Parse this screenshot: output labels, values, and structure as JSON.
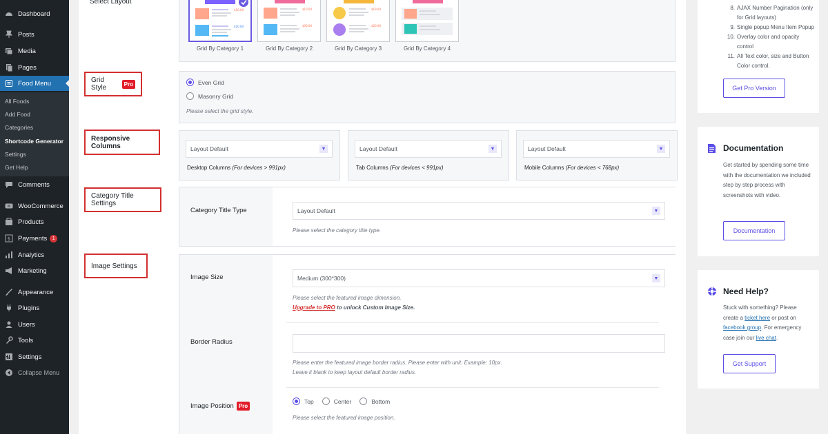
{
  "sidebar": {
    "items": [
      {
        "label": "Dashboard",
        "icon": "dashboard-icon"
      },
      {
        "label": "Posts",
        "icon": "pin-icon"
      },
      {
        "label": "Media",
        "icon": "media-icon"
      },
      {
        "label": "Pages",
        "icon": "pages-icon"
      },
      {
        "label": "Food Menu",
        "icon": "food-menu-icon"
      },
      {
        "label": "Comments",
        "icon": "comment-icon"
      },
      {
        "label": "WooCommerce",
        "icon": "woocommerce-icon"
      },
      {
        "label": "Products",
        "icon": "products-icon"
      },
      {
        "label": "Payments",
        "icon": "payments-icon",
        "badge": "1"
      },
      {
        "label": "Analytics",
        "icon": "analytics-icon"
      },
      {
        "label": "Marketing",
        "icon": "megaphone-icon"
      },
      {
        "label": "Appearance",
        "icon": "brush-icon"
      },
      {
        "label": "Plugins",
        "icon": "plugin-icon"
      },
      {
        "label": "Users",
        "icon": "users-icon"
      },
      {
        "label": "Tools",
        "icon": "tools-icon"
      },
      {
        "label": "Settings",
        "icon": "settings-icon"
      },
      {
        "label": "Collapse Menu",
        "icon": "collapse-icon"
      }
    ],
    "submenu": [
      "All Foods",
      "Add Food",
      "Categories",
      "Shortcode Generator",
      "Settings",
      "Get Help"
    ]
  },
  "layout": {
    "heading": "Select Layout",
    "options": [
      "Grid By Category 1",
      "Grid By Category 2",
      "Grid By Category 3",
      "Grid By Category 4"
    ],
    "prices": [
      "$10.00",
      "$20.00",
      "$10.00",
      "$30.00",
      "$19.00",
      "$20.00"
    ]
  },
  "grid_style": {
    "label": "Grid Style",
    "pro": "Pro",
    "options": [
      "Even Grid",
      "Masonry Grid"
    ],
    "help": "Please select the grid style."
  },
  "responsive": {
    "label": "Responsive Columns",
    "columns": [
      {
        "value": "Layout Default",
        "label": "Desktop Columns",
        "hint": "(For devices > 991px)"
      },
      {
        "value": "Layout Default",
        "label": "Tab Columns",
        "hint": "(For devices < 991px)"
      },
      {
        "value": "Layout Default",
        "label": "Mobile Columns",
        "hint": "(For devices < 768px)"
      }
    ]
  },
  "category_title": {
    "label": "Category Title Settings",
    "field": "Category Title Type",
    "value": "Layout Default",
    "help": "Please select the category title type."
  },
  "image_settings": {
    "label": "Image Settings",
    "size_label": "Image Size",
    "size_value": "Medium (300*300)",
    "size_help": "Please select the featured image dimension.",
    "upgrade_link": "Upgrade to PRO",
    "upgrade_rest": " to unlock Custom Image Size.",
    "radius_label": "Border Radius",
    "radius_help1": "Please enter the featured image border radius. Please enter with unit. Example: 10px.",
    "radius_help2": "Leave it blank to keep layout default border radius.",
    "position_label": "Image Position",
    "pro": "Pro",
    "positions": [
      "Top",
      "Center",
      "Bottom"
    ],
    "position_help": "Please select the featured image position."
  },
  "pro_card": {
    "features": [
      {
        "num": "8.",
        "text": "AJAX Number Pagination (only for Grid layouts)"
      },
      {
        "num": "9.",
        "text": "Single popup Menu Item Popup"
      },
      {
        "num": "10.",
        "text": "Overlay color and opacity control"
      },
      {
        "num": "11.",
        "text": "All Text color, size and Button Color control."
      }
    ],
    "button": "Get Pro Version"
  },
  "doc_card": {
    "title": "Documentation",
    "text": "Get started by spending some time with the documentation we included step by step process with screenshots with video.",
    "button": "Documentation"
  },
  "help_card": {
    "title": "Need Help?",
    "t1": "Stuck with something? Please create a ",
    "l1": "ticket here",
    "t2": " or post on ",
    "l2": "facebook group",
    "t3": ". For emergency case join our ",
    "l3": "live chat",
    "t4": ".",
    "button": "Get Support"
  },
  "colors": {
    "accent": "#5b4ee6",
    "wp_blue": "#2271b1",
    "sidebar": "#1d2327",
    "pro_red": "#e11d2a"
  }
}
